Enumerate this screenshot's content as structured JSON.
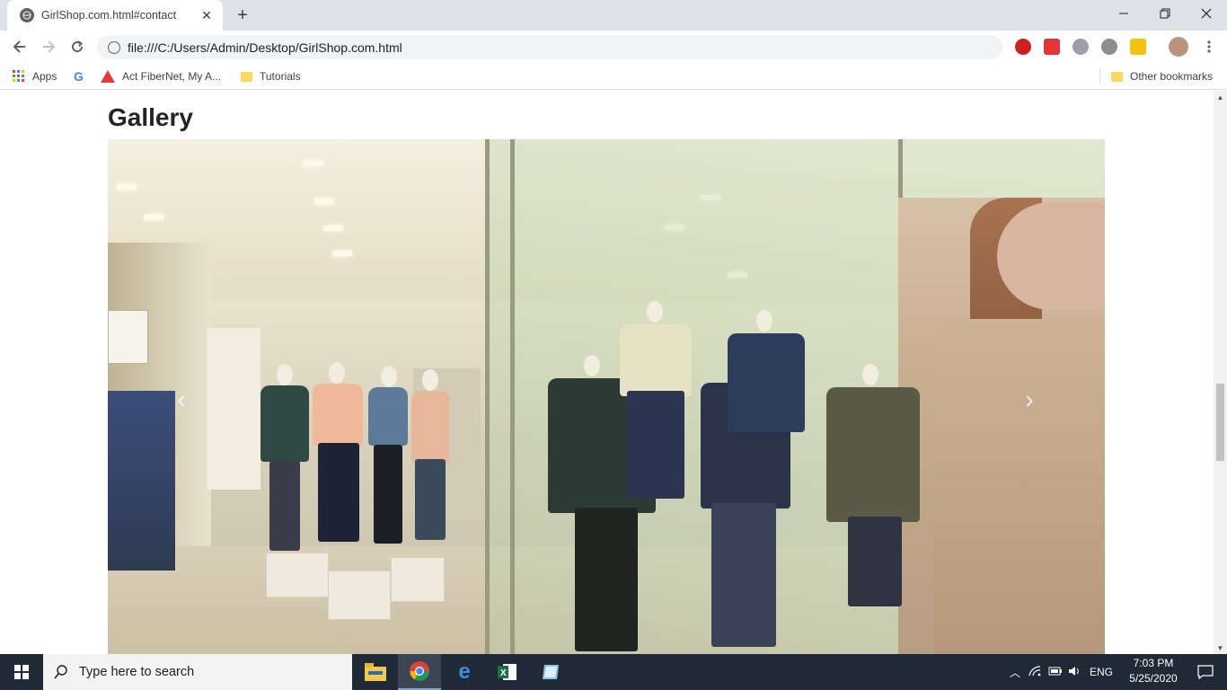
{
  "browser": {
    "tab_title": "GirlShop.com.html#contact",
    "url": "file:///C:/Users/Admin/Desktop/GirlShop.com.html",
    "bookmarks": [
      {
        "label": "Apps",
        "icon": "apps-grid-icon"
      },
      {
        "label": "",
        "icon": "google-icon"
      },
      {
        "label": "Act FiberNet, My A...",
        "icon": "act-fibernet-icon"
      },
      {
        "label": "Tutorials",
        "icon": "folder-icon"
      }
    ],
    "other_bookmarks": "Other bookmarks"
  },
  "page": {
    "section_title": "Gallery",
    "carousel": {
      "prev_symbol": "‹",
      "next_symbol": "›"
    }
  },
  "taskbar": {
    "search_placeholder": "Type here to search",
    "language": "ENG",
    "time": "7:03 PM",
    "date": "5/25/2020"
  },
  "colors": {
    "taskbar": "#1f2a36",
    "tabstrip": "#dee1e6",
    "omnibox": "#f1f3f4"
  }
}
